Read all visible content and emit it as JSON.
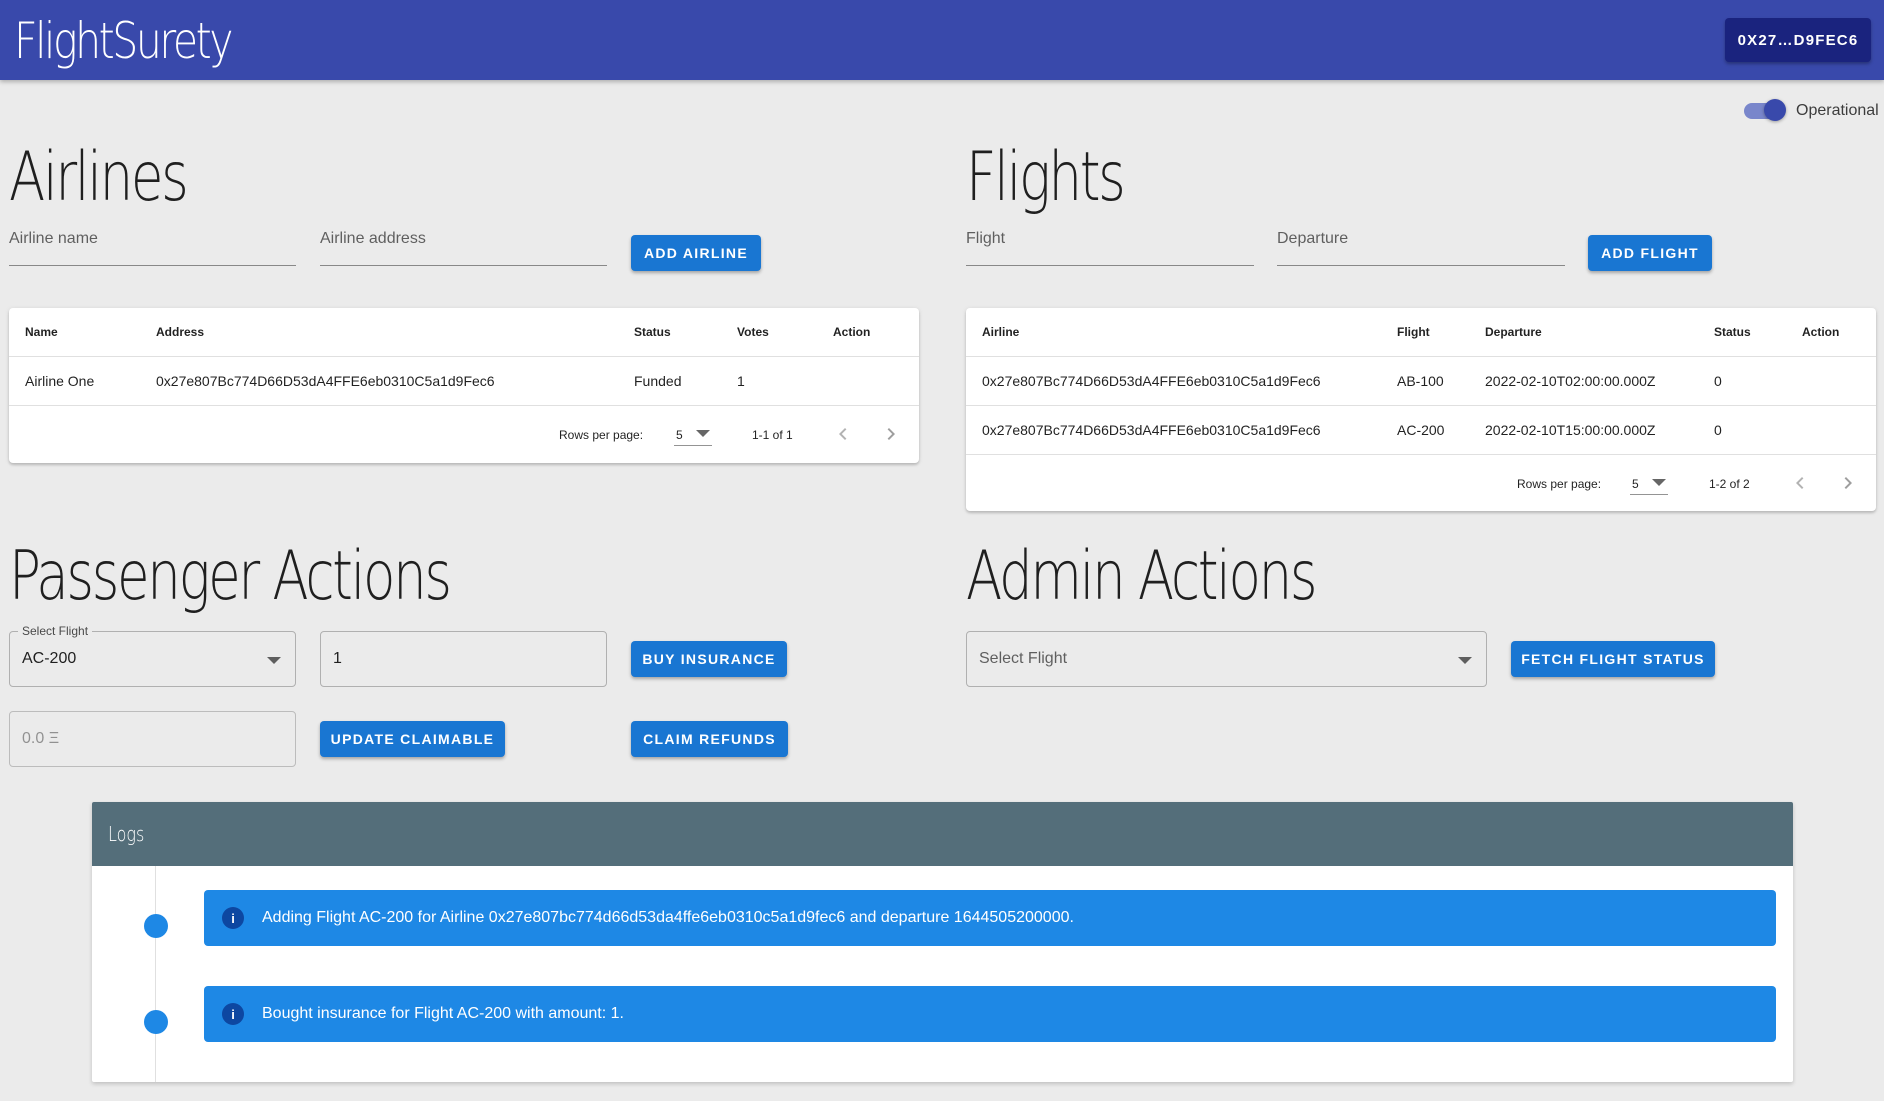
{
  "header": {
    "app_title": "FlightSurety",
    "account_label": "0X27…D9FEC6"
  },
  "operational": {
    "label": "Operational",
    "on": true
  },
  "airlines": {
    "title": "Airlines",
    "name_placeholder": "Airline name",
    "address_placeholder": "Airline address",
    "add_button": "ADD AIRLINE",
    "table": {
      "columns": [
        "Name",
        "Address",
        "Status",
        "Votes",
        "Action"
      ],
      "rows": [
        {
          "name": "Airline One",
          "address": "0x27e807Bc774D66D53dA4FFE6eb0310C5a1d9Fec6",
          "status": "Funded",
          "votes": "1",
          "action": ""
        }
      ],
      "rows_per_page_label": "Rows per page:",
      "rows_per_page": "5",
      "range": "1-1 of 1"
    }
  },
  "flights": {
    "title": "Flights",
    "flight_placeholder": "Flight",
    "departure_placeholder": "Departure",
    "add_button": "ADD FLIGHT",
    "table": {
      "columns": [
        "Airline",
        "Flight",
        "Departure",
        "Status",
        "Action"
      ],
      "rows": [
        {
          "airline": "0x27e807Bc774D66D53dA4FFE6eb0310C5a1d9Fec6",
          "flight": "AB-100",
          "departure": "2022-02-10T02:00:00.000Z",
          "status": "0",
          "action": ""
        },
        {
          "airline": "0x27e807Bc774D66D53dA4FFE6eb0310C5a1d9Fec6",
          "flight": "AC-200",
          "departure": "2022-02-10T15:00:00.000Z",
          "status": "0",
          "action": ""
        }
      ],
      "rows_per_page_label": "Rows per page:",
      "rows_per_page": "5",
      "range": "1-2 of 2"
    }
  },
  "passenger": {
    "title": "Passenger Actions",
    "select_legend": "Select Flight",
    "selected_flight": "AC-200",
    "amount_value": "1",
    "buy_button": "BUY INSURANCE",
    "claimable_value": "0.0 Ξ",
    "update_button": "UPDATE CLAIMABLE",
    "claim_button": "CLAIM REFUNDS"
  },
  "admin": {
    "title": "Admin Actions",
    "select_placeholder": "Select Flight",
    "fetch_button": "FETCH FLIGHT STATUS"
  },
  "logs": {
    "title": "Logs",
    "entries": [
      "Adding Flight AC-200 for Airline 0x27e807bc774d66d53da4ffe6eb0310c5a1d9fec6 and departure 1644505200000.",
      "Bought insurance for Flight AC-200 with amount: 1."
    ]
  },
  "colors": {
    "toolbar": "#3949ab",
    "account_button": "#1a237e",
    "primary_button": "#1976d2",
    "alert_info": "#1e88e5",
    "logs_header": "#546e7a"
  }
}
